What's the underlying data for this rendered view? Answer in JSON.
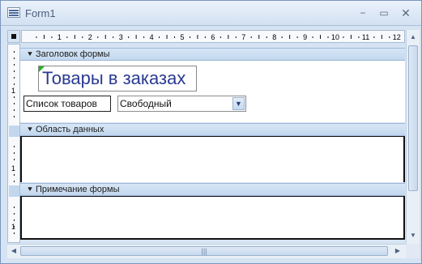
{
  "window": {
    "title": "Form1",
    "icon": "form-icon",
    "minimize_glyph": "−",
    "maximize_glyph": "▭",
    "close_glyph": "✕"
  },
  "ruler": {
    "marks": [
      "1",
      "2",
      "3",
      "4",
      "5",
      "6",
      "7",
      "8",
      "9",
      "10",
      "11",
      "12"
    ]
  },
  "sections": {
    "header": {
      "label": "Заголовок формы"
    },
    "detail": {
      "label": "Область данных"
    },
    "footer": {
      "label": "Примечание формы"
    }
  },
  "controls": {
    "form_title": "Товары в заказах",
    "list_label": "Список товаров",
    "combo_value": "Свободный"
  },
  "glyphs": {
    "section_arrow": "⯆",
    "dropdown": "▼",
    "up": "▲",
    "down": "▼",
    "left": "◀",
    "right": "▶",
    "thumb_grip": "|||"
  },
  "colors": {
    "title_text": "#2a3a92",
    "corner_mark": "#25b325",
    "chrome": "#d6e3f2"
  }
}
